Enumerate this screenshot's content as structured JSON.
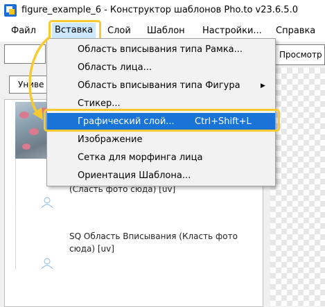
{
  "window": {
    "title": "figure_example_6 - Конструктор шаблонов Pho.to v23.6.5.0"
  },
  "menubar": {
    "items": [
      "Файл",
      "Вставка",
      "Слой",
      "Шаблон",
      "Настройки...",
      "Справка"
    ]
  },
  "toolbar": {
    "preview_label": "Просмотр",
    "universal_label": "Униве"
  },
  "dropdown": {
    "items": [
      {
        "label": "Область вписывания типа Рамка...",
        "shortcut": ""
      },
      {
        "label": "Область лица...",
        "shortcut": ""
      },
      {
        "label": "Область вписывания типа Фигура",
        "shortcut": ""
      },
      {
        "label": "Стикер...",
        "shortcut": ""
      },
      {
        "label": "Графический слой...",
        "shortcut": "Ctrl+Shift+L"
      },
      {
        "label": "Изображение",
        "shortcut": ""
      },
      {
        "label": "Сетка для морфинга лица",
        "shortcut": ""
      },
      {
        "label": "Ориентация Шаблона...",
        "shortcut": ""
      }
    ],
    "submenu_arrow": "▶",
    "selected_index": 4
  },
  "layers": {
    "items": [
      {
        "text": "(Сласть фото сюда) [uv]"
      },
      {
        "text": "SQ Область Вписывания (Класть фото сюда) [uv]"
      }
    ]
  },
  "colors": {
    "highlight": "#f7ca2f",
    "selection": "#1a73d6",
    "menu_active": "#cce8ff"
  }
}
